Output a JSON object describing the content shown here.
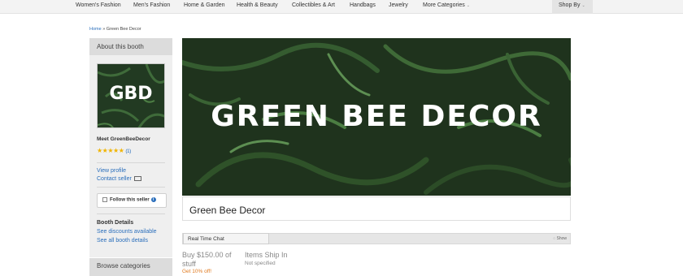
{
  "nav": {
    "items": [
      "Women's Fashion",
      "Men's Fashion",
      "Home & Garden",
      "Health & Beauty",
      "Collectibles & Art",
      "Handbags",
      "Jewelry",
      "More Categories"
    ],
    "shop_by": "Shop By"
  },
  "breadcrumb": {
    "home": "Home",
    "separator": "»",
    "current": "Green Bee Decor"
  },
  "sidebar": {
    "header": "About this booth",
    "logo_text": "GBD",
    "meet": "Meet GreenBeeDecor",
    "rating_count": "(1)",
    "view_profile": "View profile",
    "contact_seller": "Contact seller",
    "follow": "Follow this seller",
    "booth_details": "Booth Details",
    "see_discounts": "See discounts available",
    "see_all": "See all booth details",
    "browse": "Browse categories"
  },
  "banner": {
    "text": "GREEN BEE DECOR"
  },
  "booth_name": "Green Bee Decor",
  "chat": {
    "tab": "Real Time Chat",
    "show": "Show"
  },
  "promo": {
    "buy": "Buy $150.00 of stuff",
    "discount": "Get 10% off!"
  },
  "shipping": {
    "label": "Items Ship In",
    "value": "Not specified"
  },
  "colors": {
    "link": "#2a6ebb",
    "accent_orange": "#e07a1f",
    "star": "#f0b400",
    "banner_bg": "#22361f"
  }
}
